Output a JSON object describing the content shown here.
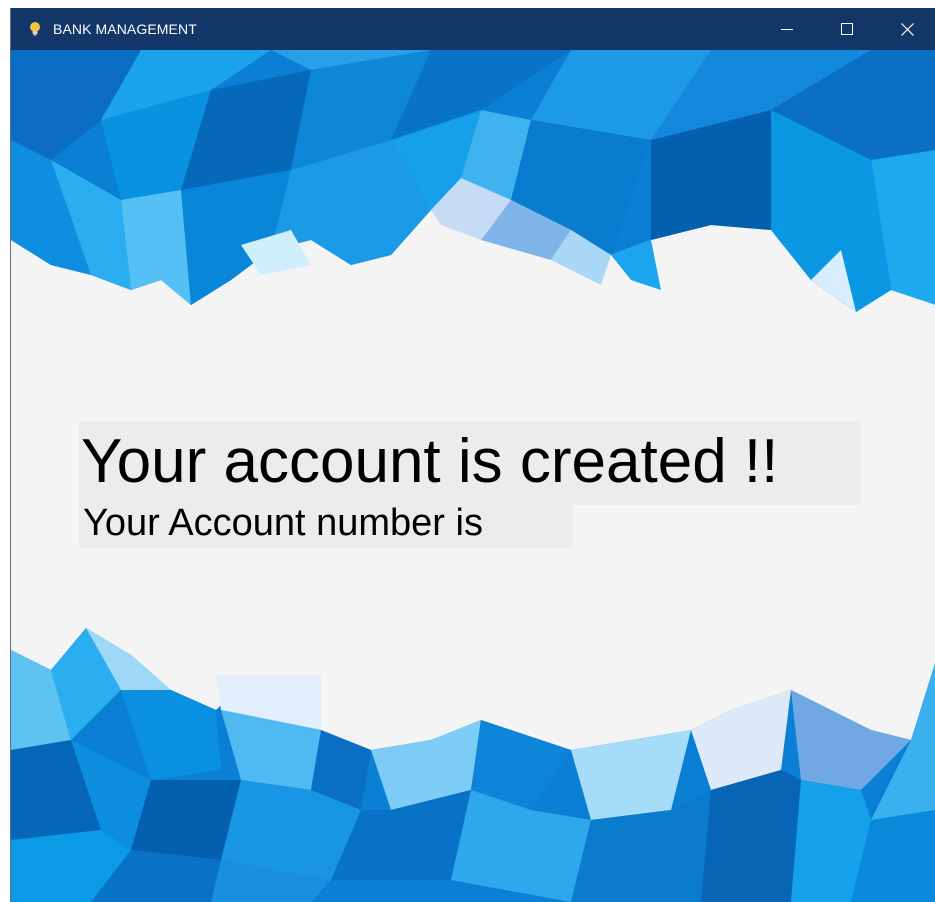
{
  "window": {
    "title": "BANK MANAGEMENT",
    "controls": {
      "minimize_icon": "minimize-icon",
      "maximize_icon": "maximize-icon",
      "close_icon": "close-icon"
    }
  },
  "message": {
    "title": "Your account is created !!",
    "subtitle": "Your Account number is"
  },
  "colors": {
    "titlebar": "#123668",
    "background": "#f4f4f4",
    "accent_blue": "#0a82d6"
  }
}
